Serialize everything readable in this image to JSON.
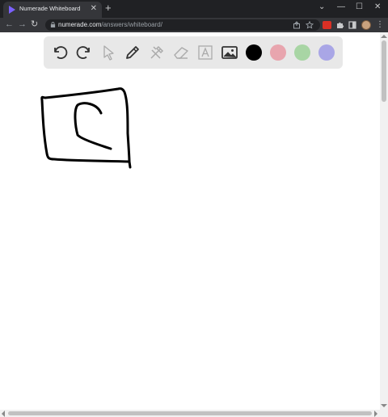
{
  "browser": {
    "tab_title": "Numerade Whiteboard",
    "tab_close": "✕",
    "new_tab": "+",
    "controls": {
      "dropdown": "⌄",
      "minimize": "—",
      "maximize": "☐",
      "close": "✕"
    },
    "nav": {
      "back": "←",
      "forward": "→",
      "reload": "↻"
    },
    "url_host": "numerade.com",
    "url_path": "/answers/whiteboard/",
    "menu": "⋮"
  },
  "extensions": [
    "share-icon",
    "bookmark-star-icon",
    "abp-extension-icon",
    "puzzle-extensions-icon",
    "sidebar-icon",
    "profile-avatar"
  ],
  "whiteboard": {
    "tools": [
      "undo",
      "redo",
      "select",
      "pen",
      "tools",
      "eraser",
      "text",
      "image"
    ],
    "colors": [
      "#000000",
      "#e8a5ae",
      "#a8d5a4",
      "#a9a6e6"
    ]
  }
}
